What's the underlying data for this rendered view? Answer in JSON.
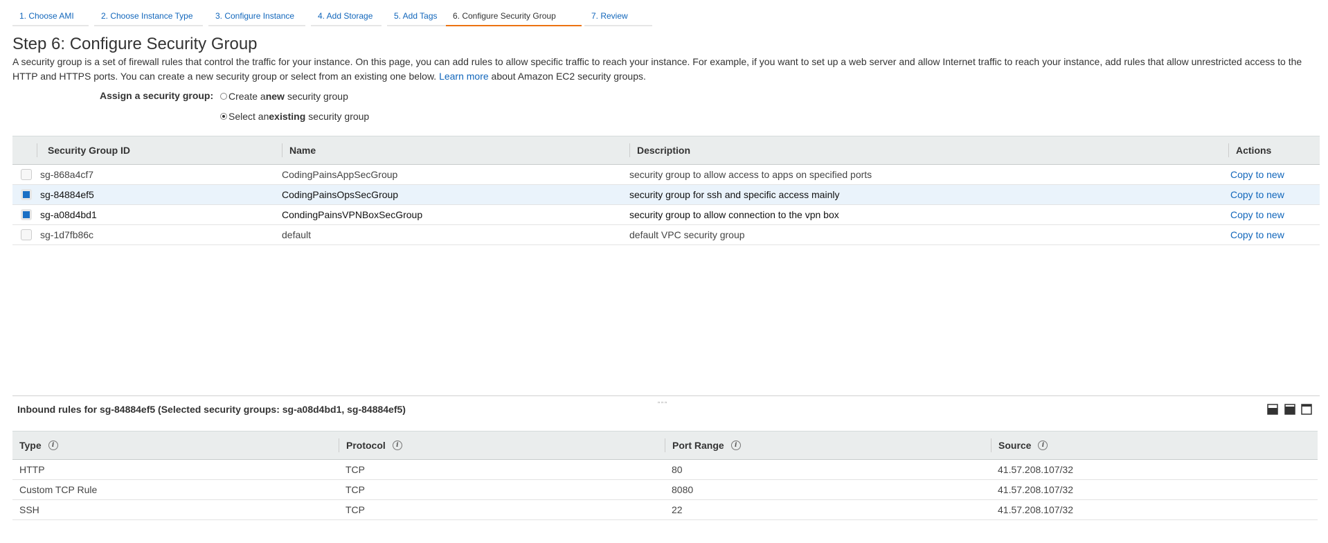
{
  "wizard": {
    "tabs": [
      {
        "label": "1. Choose AMI"
      },
      {
        "label": "2. Choose Instance Type"
      },
      {
        "label": "3. Configure Instance"
      },
      {
        "label": "4. Add Storage"
      },
      {
        "label": "5. Add Tags"
      },
      {
        "label": "6. Configure Security Group",
        "active": true
      },
      {
        "label": "7. Review"
      }
    ]
  },
  "page": {
    "title": "Step 6: Configure Security Group",
    "intro": "A security group is a set of firewall rules that control the traffic for your instance. On this page, you can add rules to allow specific traffic to reach your instance. For example, if you want to set up a web server and allow Internet traffic to reach your instance, add rules that allow unrestricted access to the HTTP and HTTPS ports. You can create a new security group or select from an existing one below.",
    "learn_more": "Learn more",
    "intro_tail": "about Amazon EC2 security groups."
  },
  "assign": {
    "label": "Assign a security group:",
    "option_new": {
      "prefix": "Create a ",
      "bold": "new",
      "suffix": " security group",
      "selected": false
    },
    "option_existing": {
      "prefix": "Select an ",
      "bold": "existing",
      "suffix": " security group",
      "selected": true
    }
  },
  "sg_table": {
    "columns": {
      "id": "Security Group ID",
      "name": "Name",
      "description": "Description",
      "actions": "Actions"
    },
    "rows": [
      {
        "id": "sg-868a4cf7",
        "name": "CodingPainsAppSecGroup",
        "description": "security group to allow access to apps on specified ports",
        "action": "Copy to new",
        "checked": false
      },
      {
        "id": "sg-84884ef5",
        "name": "CodingPainsOpsSecGroup",
        "description": "security group for ssh and specific access mainly",
        "action": "Copy to new",
        "checked": true
      },
      {
        "id": "sg-a08d4bd1",
        "name": "CondingPainsVPNBoxSecGroup",
        "description": "security group to allow connection to the vpn box",
        "action": "Copy to new",
        "checked": true
      },
      {
        "id": "sg-1d7fb86c",
        "name": "default",
        "description": "default VPC security group",
        "action": "Copy to new",
        "checked": false
      }
    ]
  },
  "inbound": {
    "title": "Inbound rules for sg-84884ef5 (Selected security groups: sg-a08d4bd1, sg-84884ef5)",
    "columns": {
      "type": "Type",
      "protocol": "Protocol",
      "port_range": "Port Range",
      "source": "Source"
    },
    "info_glyph": "i",
    "rows": [
      {
        "type": "HTTP",
        "protocol": "TCP",
        "port_range": "80",
        "source": "41.57.208.107/32"
      },
      {
        "type": "Custom TCP Rule",
        "protocol": "TCP",
        "port_range": "8080",
        "source": "41.57.208.107/32"
      },
      {
        "type": "SSH",
        "protocol": "TCP",
        "port_range": "22",
        "source": "41.57.208.107/32"
      }
    ]
  },
  "colors": {
    "accent": "#ec7211",
    "link": "#1166bb",
    "checkbox_on": "#1a6fc4",
    "row_highlight": "#eaf3fb"
  },
  "icons": {
    "info": "info-icon",
    "layout": [
      "layout-bottom-icon",
      "layout-split-icon",
      "layout-top-icon"
    ],
    "grip": "resize-grip-icon"
  }
}
